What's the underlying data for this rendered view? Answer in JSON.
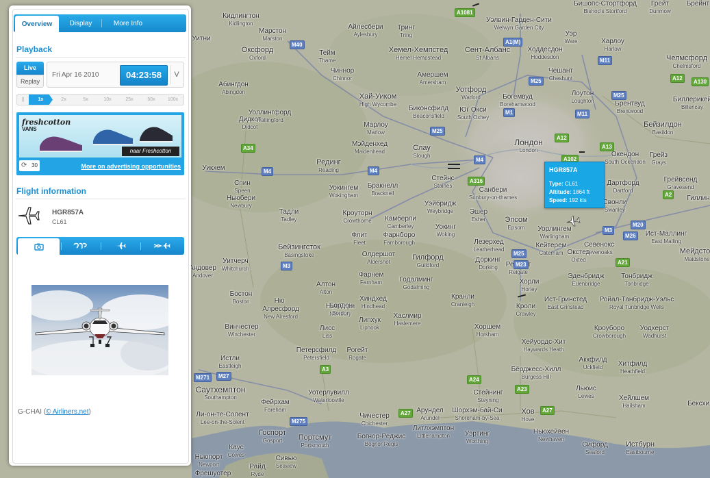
{
  "tabs": {
    "overview": "Overview",
    "display": "Display",
    "more_info": "More Info"
  },
  "playback": {
    "title": "Playback",
    "live_label": "Live",
    "replay_label": "Replay",
    "date": "Fri Apr 16 2010",
    "time": "04:23:58",
    "dropdown_symbol": "V",
    "speeds": [
      "||",
      "1x",
      "2x",
      "5x",
      "10x",
      "25x",
      "50x",
      "100x"
    ],
    "selected_speed": "1x"
  },
  "ad": {
    "brand": "freshcotton",
    "sub_brand": "VANS",
    "banner": "naar Freshcotton",
    "counter": "30",
    "link": "More on advertising opportunities"
  },
  "flight_info": {
    "title": "Flight information",
    "callsign": "HGR857A",
    "type": "CL61"
  },
  "photo": {
    "tabs": [
      "camera-icon",
      "world-map-icon",
      "plane-icon",
      "fast-forward-plane-icon"
    ],
    "credit_reg": "G-CHAI",
    "credit_open": "(",
    "credit_link": "© Airliners.net",
    "credit_close": ")"
  },
  "popup": {
    "callsign": "HGR857A",
    "type_label": "Type:",
    "type": "CL61",
    "altitude_label": "Altitude:",
    "altitude": "1864 ft",
    "speed_label": "Speed:",
    "speed": "192 kts"
  },
  "map": {
    "cities": [
      {
        "ru": "Кидлингтон",
        "en": "Kidlington"
      },
      {
        "ru": "Айлесбери",
        "en": "Aylesbury"
      },
      {
        "ru": "Тринг",
        "en": "Tring"
      },
      {
        "ru": "Уэлвин-Гарден-Сити",
        "en": "Welwyn Garden City"
      },
      {
        "ru": "Бишопс-Стортфорд",
        "en": "Bishop's Stortford"
      },
      {
        "ru": "Грейт",
        "en": "Dunmow"
      },
      {
        "ru": "Брейнтри",
        "en": ""
      },
      {
        "ru": "Марстон",
        "en": "Marston"
      },
      {
        "ru": "Уитни",
        "en": ""
      },
      {
        "ru": "Оксфорд",
        "en": "Oxford"
      },
      {
        "ru": "Тейм",
        "en": "Thame"
      },
      {
        "ru": "Хемел-Хемпстед",
        "en": "Hemel Hempstead"
      },
      {
        "ru": "Сент-Албанс",
        "en": "St Albans"
      },
      {
        "ru": "Уэр",
        "en": "Ware"
      },
      {
        "ru": "Харлоу",
        "en": "Harlow"
      },
      {
        "ru": "Ходдесдон",
        "en": "Hoddesdon"
      },
      {
        "ru": "Челмсфорд",
        "en": "Chelmsford"
      },
      {
        "ru": "Чиннор",
        "en": "Chinnor"
      },
      {
        "ru": "Амершем",
        "en": "Amersham"
      },
      {
        "ru": "Чешант",
        "en": "Cheshunt"
      },
      {
        "ru": "Абингдон",
        "en": "Abingdon"
      },
      {
        "ru": "Хай-Уиком",
        "en": "High Wycombe"
      },
      {
        "ru": "Уотфорд",
        "en": "Watford"
      },
      {
        "ru": "Богемвуд",
        "en": "Borehamwood"
      },
      {
        "ru": "Лоутон",
        "en": "Loughton"
      },
      {
        "ru": "Биллерикей",
        "en": "Billericay"
      },
      {
        "ru": "Брентвуд",
        "en": "Brentwood"
      },
      {
        "ru": "Уоллингфорд",
        "en": "Wallingford"
      },
      {
        "ru": "Биконсфилд",
        "en": "Beaconsfield"
      },
      {
        "ru": "Юг Окси",
        "en": "South Oxhey"
      },
      {
        "ru": "Марлоу",
        "en": "Marlow"
      },
      {
        "ru": "Дидкот",
        "en": "Didcot"
      },
      {
        "ru": "Бейзилдон",
        "en": "Basildon"
      },
      {
        "ru": "Мэйденхед",
        "en": "Maidenhead"
      },
      {
        "ru": "Слау",
        "en": "Slough"
      },
      {
        "ru": "Лондон",
        "en": "London"
      },
      {
        "ru": "Окендон",
        "en": "South Ockendon"
      },
      {
        "ru": "Грейз",
        "en": "Grays"
      },
      {
        "ru": "Рединг",
        "en": "Reading"
      },
      {
        "ru": "Уикхем",
        "en": ""
      },
      {
        "ru": "Спин",
        "en": "Speen"
      },
      {
        "ru": "Ньюбери",
        "en": "Newbury"
      },
      {
        "ru": "Стейнс",
        "en": "Staines"
      },
      {
        "ru": "Уокингем",
        "en": "Wokingham"
      },
      {
        "ru": "Бракнелл",
        "en": "Bracknell"
      },
      {
        "ru": "Санбери",
        "en": "Sunbury-on-thames"
      },
      {
        "ru": "Дартфорд",
        "en": "Dartford"
      },
      {
        "ru": "Грейвсенд",
        "en": "Gravesend"
      },
      {
        "ru": "Кроуторн",
        "en": "Crowthorne"
      },
      {
        "ru": "Уэйбридж",
        "en": "Weybridge"
      },
      {
        "ru": "Эшер",
        "en": "Esher"
      },
      {
        "ru": "Свонли",
        "en": "Swanley"
      },
      {
        "ru": "Гиллин",
        "en": ""
      },
      {
        "ru": "Тадли",
        "en": "Tadley"
      },
      {
        "ru": "Камберли",
        "en": "Camberley"
      },
      {
        "ru": "Эпсом",
        "en": "Epsom"
      },
      {
        "ru": "Уокинг",
        "en": "Woking"
      },
      {
        "ru": "Уорлингем",
        "en": "Warlingham"
      },
      {
        "ru": "Флит",
        "en": "Fleet"
      },
      {
        "ru": "Фарнборо",
        "en": "Farnborough"
      },
      {
        "ru": "Севенокс",
        "en": "Sevenoaks"
      },
      {
        "ru": "Ист-Маллинг",
        "en": "East Malling"
      },
      {
        "ru": "Бейзингсток",
        "en": "Basingstoke"
      },
      {
        "ru": "Олдершот",
        "en": "Aldershot"
      },
      {
        "ru": "Лезерхед",
        "en": "Leatherhead"
      },
      {
        "ru": "Кейтерем",
        "en": "Caterham"
      },
      {
        "ru": "Окстед",
        "en": "Oxted"
      },
      {
        "ru": "Мейдстон",
        "en": "Maidstone"
      },
      {
        "ru": "Уитчерч",
        "en": "Whitchurch"
      },
      {
        "ru": "Гилфорд",
        "en": "Guildford"
      },
      {
        "ru": "Доркинг",
        "en": "Dorking"
      },
      {
        "ru": "Рейгейт",
        "en": "Reigate"
      },
      {
        "ru": "Андовер",
        "en": "Andover"
      },
      {
        "ru": "Фарнем",
        "en": "Farnham"
      },
      {
        "ru": "Годалминг",
        "en": "Godalming"
      },
      {
        "ru": "Эденбридж",
        "en": "Edenbridge"
      },
      {
        "ru": "Тонбридж",
        "en": "Tonbridge"
      },
      {
        "ru": "Бостон",
        "en": "Boston"
      },
      {
        "ru": "Алтон",
        "en": "Alton"
      },
      {
        "ru": "Хорли",
        "en": "Horley"
      },
      {
        "ru": "Ньюбери",
        "en": "Newbury"
      },
      {
        "ru": "Хиндхед",
        "en": "Hindhead"
      },
      {
        "ru": "Кранли",
        "en": "Cranleigh"
      },
      {
        "ru": "Ист-Гринстед",
        "en": "East Grinstead"
      },
      {
        "ru": "Ройал-Танбридж-Уэльс",
        "en": "Royal Tunbridge Wells"
      },
      {
        "ru": "Кроли",
        "en": "Crawley"
      },
      {
        "ru": "Ню",
        "en": ""
      },
      {
        "ru": "Алресфорд",
        "en": "New Alresford"
      },
      {
        "ru": "Бордон",
        "en": "Bordon"
      },
      {
        "ru": "Липхук",
        "en": "Liphook"
      },
      {
        "ru": "Хаслмир",
        "en": "Haslemere"
      },
      {
        "ru": "Винчестер",
        "en": "Winchester"
      },
      {
        "ru": "Хоршем",
        "en": "Horsham"
      },
      {
        "ru": "Кроуборо",
        "en": "Crowborough"
      },
      {
        "ru": "Уодхерст",
        "en": "Wadhurst"
      },
      {
        "ru": "Лисс",
        "en": "Liss"
      },
      {
        "ru": "Хейуордс-Хит",
        "en": "Haywards Heath"
      },
      {
        "ru": "Петерсфилд",
        "en": "Petersfield"
      },
      {
        "ru": "Рогейт",
        "en": "Rogate"
      },
      {
        "ru": "Истли",
        "en": "Eastleigh"
      },
      {
        "ru": "Бёрджесс-Хилл",
        "en": "Burgess Hill"
      },
      {
        "ru": "Аккфилд",
        "en": "Uckfield"
      },
      {
        "ru": "Хитфилд",
        "en": "Heathfield"
      },
      {
        "ru": "Саутхемптон",
        "en": "Southampton"
      },
      {
        "ru": "Уотерлувилл",
        "en": "Waterlooville"
      },
      {
        "ru": "Стейнинг",
        "en": "Steyning"
      },
      {
        "ru": "Льюис",
        "en": "Lewes"
      },
      {
        "ru": "Хейлшем",
        "en": "Hailsham"
      },
      {
        "ru": "Бексхилл",
        "en": ""
      },
      {
        "ru": "Фейрхам",
        "en": "Fareham"
      },
      {
        "ru": "Чичестер",
        "en": "Chichester"
      },
      {
        "ru": "Арундел",
        "en": "Arundel"
      },
      {
        "ru": "Шорхэм-бай-Си",
        "en": "Shoreham-by-Sea"
      },
      {
        "ru": "Хов",
        "en": "Hove"
      },
      {
        "ru": "Ли-он-те-Солент",
        "en": "Lee-on-the-Solent"
      },
      {
        "ru": "Госпорт",
        "en": "Gosport"
      },
      {
        "ru": "Портсмут",
        "en": "Portsmouth"
      },
      {
        "ru": "Богнор-Реджис",
        "en": "Bognor Regis"
      },
      {
        "ru": "Литлхэмптон",
        "en": "Littlehampton"
      },
      {
        "ru": "Уэртинг",
        "en": "Worthing"
      },
      {
        "ru": "Ньюхейвен",
        "en": "Newhaven"
      },
      {
        "ru": "Сифорд",
        "en": "Seaford"
      },
      {
        "ru": "Истбурн",
        "en": "Eastbourne"
      },
      {
        "ru": "Каус",
        "en": "Cowes"
      },
      {
        "ru": "Ньюпорт",
        "en": "Newport"
      },
      {
        "ru": "Сивью",
        "en": "Seaview"
      },
      {
        "ru": "Райд",
        "en": "Ryde"
      },
      {
        "ru": "Фрешуотер",
        "en": ""
      }
    ],
    "roads": [
      "A1081",
      "A1(M)",
      "A12",
      "A130",
      "M40",
      "M11",
      "M25",
      "M1",
      "M25",
      "M11",
      "M25",
      "A12",
      "A13",
      "A2",
      "A34",
      "M4",
      "M4",
      "A316",
      "M4",
      "M3",
      "M25",
      "M23",
      "M20",
      "M26",
      "A21",
      "M3",
      "M271",
      "M27",
      "A3",
      "A24",
      "A23",
      "A27",
      "A27",
      "M275",
      "A102"
    ]
  }
}
